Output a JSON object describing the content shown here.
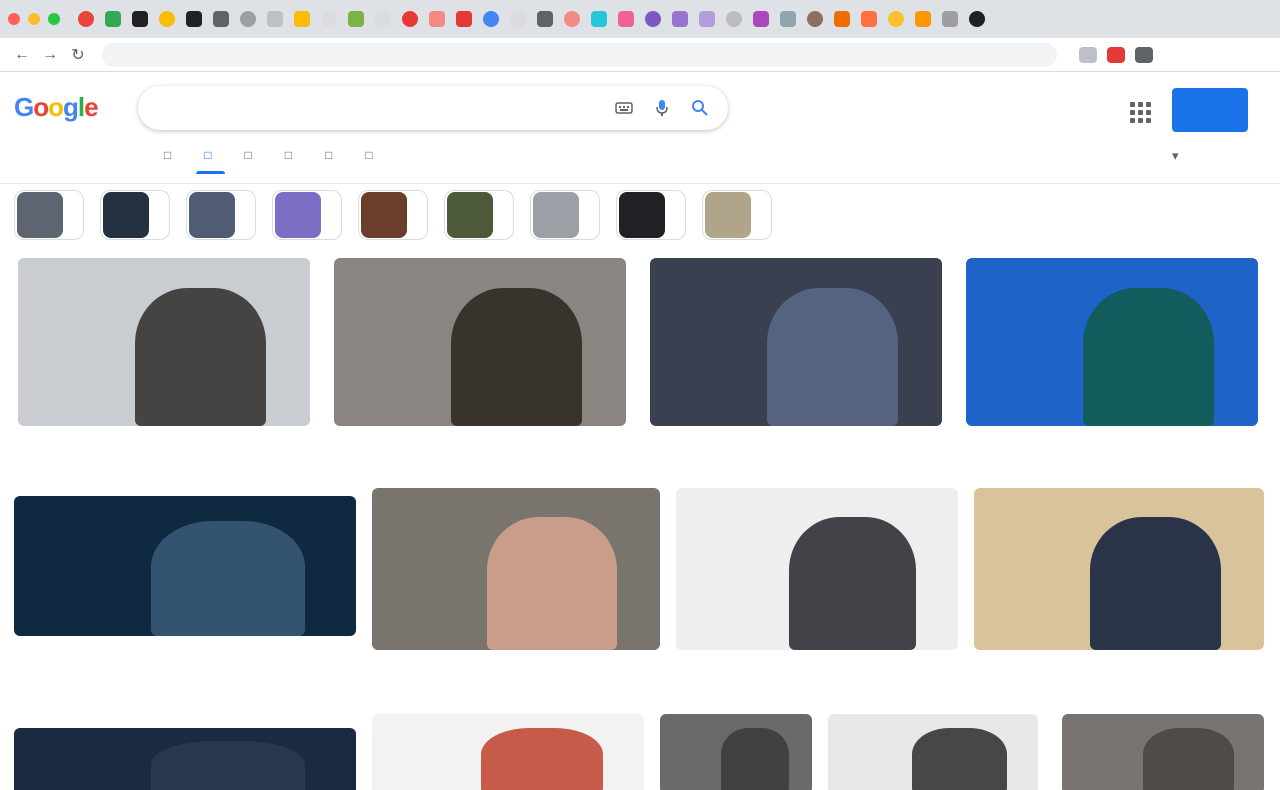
{
  "browser": {
    "window_colors": [
      "#ff5f57",
      "#febc2e",
      "#28c840"
    ],
    "tab_favicons": [
      "#e8453c",
      "#34a853",
      "#202124",
      "#fbbc05",
      "#202124",
      "#5f6368",
      "#9aa0a6",
      "#bdc1c6",
      "#fbbc05",
      "#dadce0",
      "#7cb342",
      "#dadce0",
      "#e53935",
      "#f28b82",
      "#e53935",
      "#4285f4",
      "#dadce0",
      "#5f6368",
      "#f28b82",
      "#26c6da",
      "#f06292",
      "#7e57c2",
      "#9575cd",
      "#b39ddb",
      "#bdbdbd",
      "#ab47bc",
      "#90a4ae",
      "#8d6e63",
      "#ef6c00",
      "#ff7043",
      "#fbc02d",
      "#ff9800",
      "#9e9e9e",
      "#202124"
    ],
    "url": "",
    "ext_colors": [
      "#bdc1c6",
      "#e53935",
      "#5f6368"
    ]
  },
  "google": {
    "logo_letters": [
      {
        "ch": "G",
        "color": "#4285f4"
      },
      {
        "ch": "o",
        "color": "#ea4335"
      },
      {
        "ch": "o",
        "color": "#fbbc05"
      },
      {
        "ch": "g",
        "color": "#4285f4"
      },
      {
        "ch": "l",
        "color": "#34a853"
      },
      {
        "ch": "e",
        "color": "#ea4335"
      }
    ],
    "query": "",
    "signin_label": "",
    "safesearch_label": ""
  },
  "tabs": [
    {
      "label": "",
      "active": false
    },
    {
      "label": "",
      "active": true
    },
    {
      "label": "",
      "active": false
    },
    {
      "label": "",
      "active": false
    },
    {
      "label": "",
      "active": false
    },
    {
      "label": "",
      "active": false
    },
    {
      "label": "",
      "active": false
    },
    {
      "label": "",
      "active": false
    }
  ],
  "chips": [
    {
      "label": "",
      "thumb": "#5d6670"
    },
    {
      "label": "",
      "thumb": "#243140"
    },
    {
      "label": "",
      "thumb": "#4f5c74"
    },
    {
      "label": "",
      "thumb": "#7a6fc4"
    },
    {
      "label": "",
      "thumb": "#6a3e2a"
    },
    {
      "label": "",
      "thumb": "#4d5a3a"
    },
    {
      "label": "",
      "thumb": "#9aa0a6"
    },
    {
      "label": "",
      "thumb": "#1f2124"
    },
    {
      "label": "",
      "thumb": "#b0a48a"
    }
  ],
  "images": [
    {
      "title": "",
      "source": "",
      "bg": "#c9ccd0",
      "fg": "#2f2a2a"
    },
    {
      "title": "",
      "source": "",
      "bg": "#8a8580",
      "fg": "#2a2420"
    },
    {
      "title": "",
      "source": "",
      "bg": "#3a4050",
      "fg": "#5a6a8a"
    },
    {
      "title": "",
      "source": "",
      "bg": "#1e63c8",
      "fg": "#125a4a"
    },
    {
      "title": "",
      "source": "",
      "bg": "#0f2a40",
      "fg": "#3a5a7a"
    },
    {
      "title": "",
      "source": "",
      "bg": "#7a746e",
      "fg": "#d8a590"
    },
    {
      "title": "",
      "source": "",
      "bg": "#eeeeee",
      "fg": "#22252c"
    },
    {
      "title": "",
      "source": "",
      "bg": "#d9c39a",
      "fg": "#0a1a3a"
    },
    {
      "title": "",
      "source": "",
      "bg": "#1a2a40",
      "fg": "#2a3a50"
    },
    {
      "title": "",
      "source": "",
      "bg": "#f2f2f2",
      "fg": "#c0412b"
    },
    {
      "title": "",
      "source": "",
      "bg": "#6a6a6a",
      "fg": "#3a3a3a"
    },
    {
      "title": "",
      "source": "",
      "bg": "#e8e8e8",
      "fg": "#2a2a2a"
    },
    {
      "title": "",
      "source": "",
      "bg": "#7a7470",
      "fg": "#4a4440"
    }
  ]
}
